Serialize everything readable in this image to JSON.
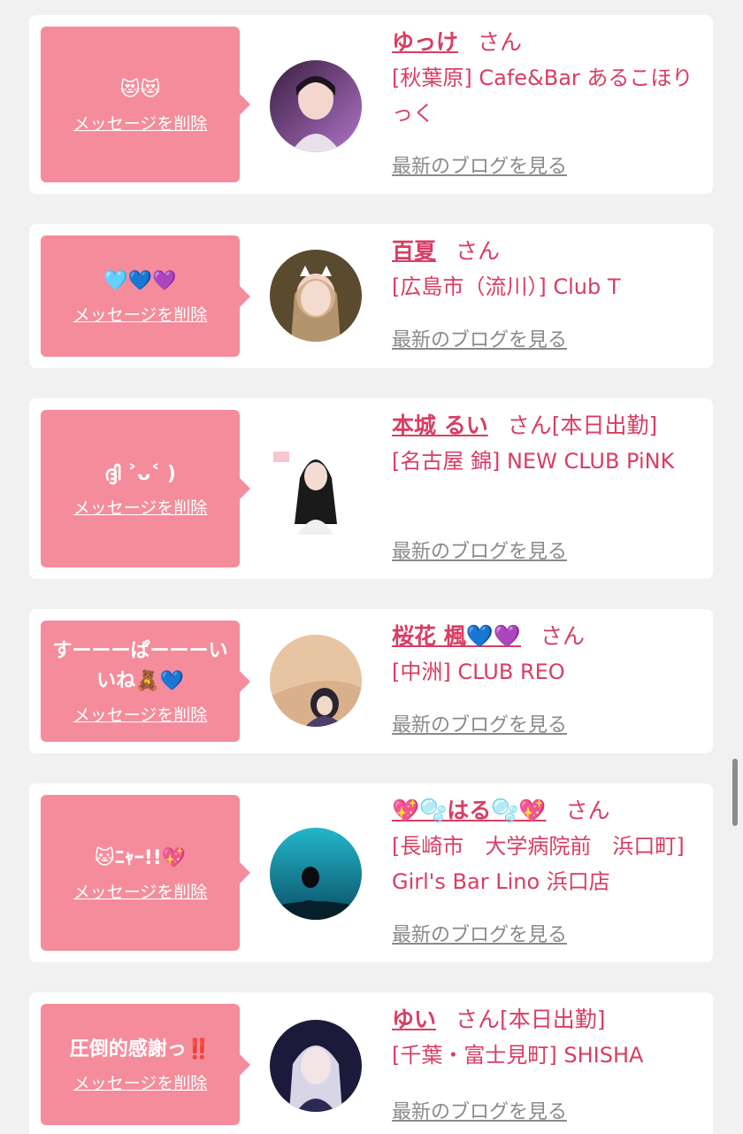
{
  "delete_label": "メッセージを削除",
  "suffix": "さん",
  "blog_label": "最新のブログを見る",
  "items": [
    {
      "message": "😻😻",
      "name": "ゆっけ",
      "tag": "",
      "shop": "[秋葉原] Cafe&Bar あるこほりっく"
    },
    {
      "message": "🩵💙💜",
      "name": "百夏",
      "tag": "",
      "shop": "[広島市（流川）] Club T"
    },
    {
      "message": "ദ്ദി ˃ᴗ˂ )",
      "name": "本城 るい",
      "tag": "[本日出勤]",
      "shop": "[名古屋 錦] NEW CLUB PiNK"
    },
    {
      "message": "すーーーぱーーーいいね🧸💙",
      "name": "桜花 楓💙💜",
      "tag": "",
      "shop": "[中洲] CLUB REO"
    },
    {
      "message": "🐱ﾆｬｰ!!💖",
      "name": "💖🫧はる🫧💖",
      "tag": "",
      "shop": "[長崎市　大学病院前　浜口町] Girl's Bar Lino 浜口店"
    },
    {
      "message": "圧倒的感謝っ‼️",
      "name": "ゆい",
      "tag": "[本日出勤]",
      "shop": "[千葉・富士見町] SHISHA"
    }
  ],
  "colors": {
    "accent": "#d93d63",
    "bubble": "#f58c9b",
    "background": "#f1f1f1",
    "link_gray": "#8a8a8a"
  }
}
